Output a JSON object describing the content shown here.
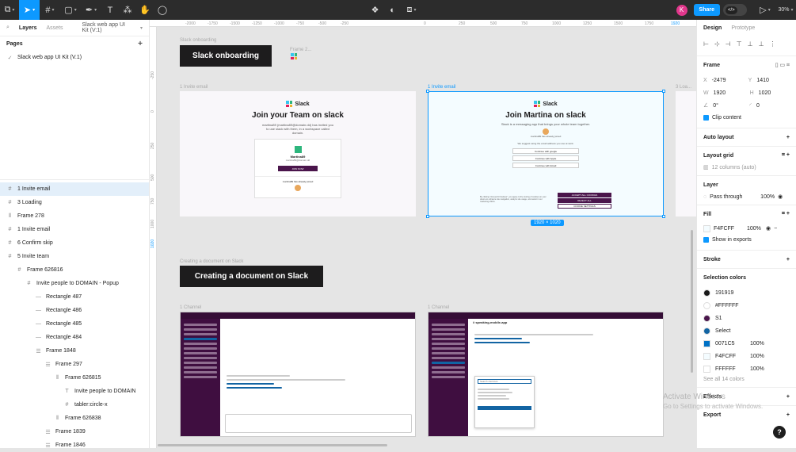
{
  "toolbar": {
    "present_zoom": "30%",
    "share_label": "Share",
    "avatar_letter": "K",
    "code_label": "</>"
  },
  "left_panel": {
    "tabs": [
      "Layers",
      "Assets"
    ],
    "file_name": "Slack web app UI Kit (V:1)",
    "pages_label": "Pages",
    "pages": [
      "Slack web app UI Kit (V.1)"
    ],
    "layers": [
      {
        "name": "1 Invite email",
        "icon": "frame-icon",
        "indent": 0,
        "selected": true
      },
      {
        "name": "3 Loading",
        "icon": "frame-icon",
        "indent": 0
      },
      {
        "name": "Frame 278",
        "icon": "columns-icon",
        "indent": 0
      },
      {
        "name": "1 Invite email",
        "icon": "frame-icon",
        "indent": 0
      },
      {
        "name": "6 Confirm skip",
        "icon": "frame-icon",
        "indent": 0
      },
      {
        "name": "5 Invite team",
        "icon": "frame-icon",
        "indent": 0
      },
      {
        "name": "Frame 626816",
        "icon": "frame-icon",
        "indent": 1
      },
      {
        "name": "Invite people to DOMAIN - Popup",
        "icon": "frame-icon",
        "indent": 2
      },
      {
        "name": "Rectangle 487",
        "icon": "rect-icon",
        "indent": 3
      },
      {
        "name": "Rectangle 486",
        "icon": "rect-icon",
        "indent": 3
      },
      {
        "name": "Rectangle 485",
        "icon": "rect-icon",
        "indent": 3
      },
      {
        "name": "Rectangle 484",
        "icon": "rect-icon",
        "indent": 3
      },
      {
        "name": "Frame 1848",
        "icon": "list-icon",
        "indent": 3
      },
      {
        "name": "Frame 297",
        "icon": "list-icon",
        "indent": 4
      },
      {
        "name": "Frame 626815",
        "icon": "columns-icon",
        "indent": 5
      },
      {
        "name": "Invite people to DOMAIN",
        "icon": "text-icon",
        "indent": 6
      },
      {
        "name": "tabler:circle-x",
        "icon": "frame-icon",
        "indent": 6
      },
      {
        "name": "Frame 626838",
        "icon": "columns-icon",
        "indent": 5
      },
      {
        "name": "Frame 1839",
        "icon": "list-icon",
        "indent": 4
      },
      {
        "name": "Frame 1846",
        "icon": "list-icon",
        "indent": 4
      }
    ]
  },
  "ruler": {
    "top_ticks": [
      "-2000",
      "-1750",
      "-1500",
      "-1250",
      "-1000",
      "-750",
      "-500",
      "-250",
      "0",
      "250",
      "500",
      "750",
      "1000",
      "1250",
      "1500",
      "1750",
      "1920"
    ],
    "left_ticks": [
      "-250",
      "0",
      "250",
      "500",
      "750",
      "1000",
      "1020"
    ]
  },
  "canvas": {
    "banner1_label": "Slack onboarding",
    "banner1_text": "Slack onboarding",
    "frame2_label": "Frame 2...",
    "invite1_label": "1 Invite email",
    "invite2_label": "1 Invite email",
    "invite3_label": "3 Loa...",
    "brand": "Slack",
    "invite1_heading": "Join your Team on slack",
    "invite1_sub": "martina89 (martina89@domain.dd) has invited you to use slack with them, in a workspace called domain.",
    "invite1_card_name": "Martina89",
    "invite1_card_email": "martina89@domain.dd",
    "invite1_button": "JOIN NOW",
    "invite1_joined": "martina89 has already joined",
    "invite2_heading": "Join Martina on slack",
    "invite2_sub": "Slack is a messaging app that brings your whole team together.",
    "invite2_joined": "martina89 has already joined",
    "invite2_suggest": "We suggest using the email address you use at work.",
    "invite2_opt1": "Continue with google",
    "invite2_opt2": "Continue with Apple",
    "invite2_opt3": "Continue with Email",
    "invite2_btn1": "ACCEPT ALL COOKIES",
    "invite2_btn2": "REJECT ALL",
    "invite2_btn3": "COOKIE SETTINGS",
    "invite2_footer": "By clicking \"Accept All Cookies\", you agree to the storing of cookies on your device to enhance site navigation, analyze site usage, and assist in our marketing efforts.",
    "selection_size": "1920 × 1020",
    "banner2_label": "Creating a document on Slack",
    "banner2_text": "Creating a document on Slack",
    "channel1_label": "1 Channel",
    "channel2_label": "1 Channel",
    "channel2_header": "# speaking-mobile-app",
    "channel2_search": "Search shortcuts"
  },
  "right_panel": {
    "tabs": [
      "Design",
      "Prototype"
    ],
    "frame_label": "Frame",
    "x_label": "X",
    "x_value": "-2479",
    "y_label": "Y",
    "y_value": "1410",
    "w_label": "W",
    "w_value": "1920",
    "h_label": "H",
    "h_value": "1020",
    "rotation": "0°",
    "radius": "0",
    "clip_content": "Clip content",
    "auto_layout": "Auto layout",
    "layout_grid": "Layout grid",
    "grid_value": "12 columns (auto)",
    "layer_label": "Layer",
    "blend": "Pass through",
    "layer_opacity": "100%",
    "fill_label": "Fill",
    "fill_hex": "F4FCFF",
    "fill_opacity": "100%",
    "show_exports": "Show in exports",
    "stroke_label": "Stroke",
    "selection_colors_label": "Selection colors",
    "selection_colors": [
      {
        "name": "191919",
        "color": "#191919",
        "opacity": "",
        "shape": "circle"
      },
      {
        "name": "#FFFFFF",
        "color": "#FFFFFF",
        "opacity": "",
        "shape": "circle"
      },
      {
        "name": "S1",
        "color": "#4a154b",
        "opacity": "",
        "shape": "circle"
      },
      {
        "name": "Select",
        "color": "#1264a3",
        "opacity": "",
        "shape": "circle"
      },
      {
        "name": "0071C5",
        "color": "#0071c5",
        "opacity": "100%",
        "shape": "square"
      },
      {
        "name": "F4FCFF",
        "color": "#F4FCFF",
        "opacity": "100%",
        "shape": "square"
      },
      {
        "name": "FFFFFF",
        "color": "#FFFFFF",
        "opacity": "100%",
        "shape": "square"
      }
    ],
    "see_all": "See all 14 colors",
    "effects_label": "Effects",
    "export_label": "Export"
  },
  "watermark": {
    "line1": "Activate Windows",
    "line2": "Go to Settings to activate Windows."
  },
  "colors": {
    "accent": "#0d99ff",
    "slack_purple": "#4a154b",
    "toolbar_bg": "#2c2c2c"
  }
}
